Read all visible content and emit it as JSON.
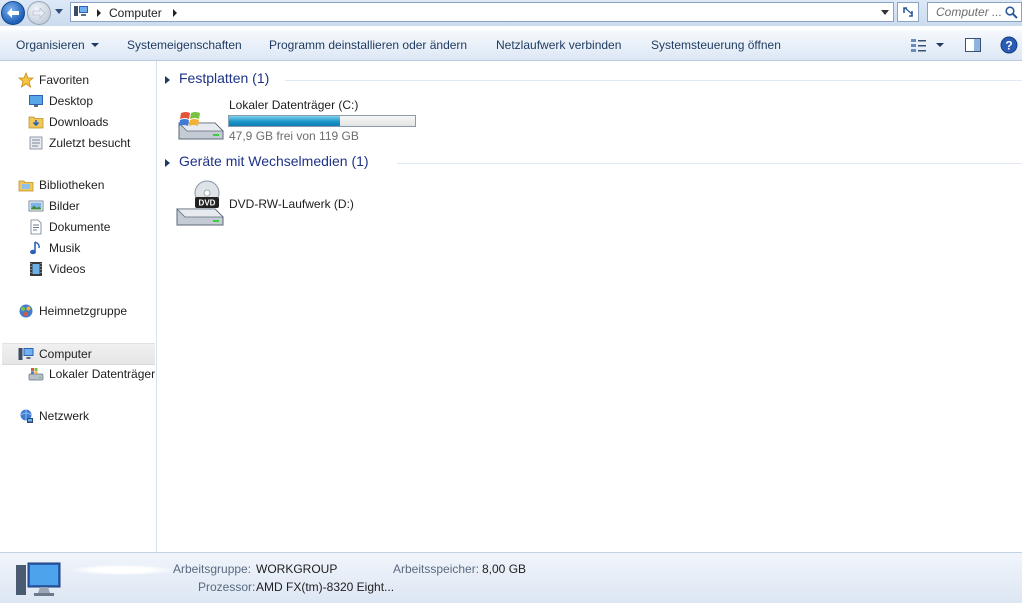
{
  "address_bar": {
    "breadcrumb": [
      "Computer"
    ],
    "search_placeholder": "Computer ..."
  },
  "toolbar": {
    "organize_label": "Organisieren",
    "items": [
      "Systemeigenschaften",
      "Programm deinstallieren oder ändern",
      "Netzlaufwerk verbinden",
      "Systemsteuerung öffnen"
    ]
  },
  "nav": {
    "favorites": {
      "label": "Favoriten",
      "items": [
        "Desktop",
        "Downloads",
        "Zuletzt besucht"
      ]
    },
    "libraries": {
      "label": "Bibliotheken",
      "items": [
        "Bilder",
        "Dokumente",
        "Musik",
        "Videos"
      ]
    },
    "homegroup": {
      "label": "Heimnetzgruppe"
    },
    "computer": {
      "label": "Computer",
      "items": [
        "Lokaler Datenträger"
      ]
    },
    "network": {
      "label": "Netzwerk"
    }
  },
  "content": {
    "hard_disks": {
      "title": "Festplatten (1)",
      "drives": [
        {
          "name": "Lokaler Datenträger (C:)",
          "free_text": "47,9 GB frei von 119 GB",
          "used_fraction": 0.597
        }
      ]
    },
    "removable": {
      "title": "Geräte mit Wechselmedien (1)",
      "drives": [
        {
          "name": "DVD-RW-Laufwerk (D:)",
          "badge": "DVD"
        }
      ]
    }
  },
  "details": {
    "workgroup_label": "Arbeitsgruppe:",
    "workgroup_value": "WORKGROUP",
    "memory_label": "Arbeitsspeicher:",
    "memory_value": "8,00 GB",
    "processor_label": "Prozessor:",
    "processor_value": "AMD FX(tm)-8320 Eight..."
  },
  "colors": {
    "link_blue": "#1e3287",
    "bar_fill": "#1b95c9",
    "toolbar_text": "#1e3a5f"
  }
}
